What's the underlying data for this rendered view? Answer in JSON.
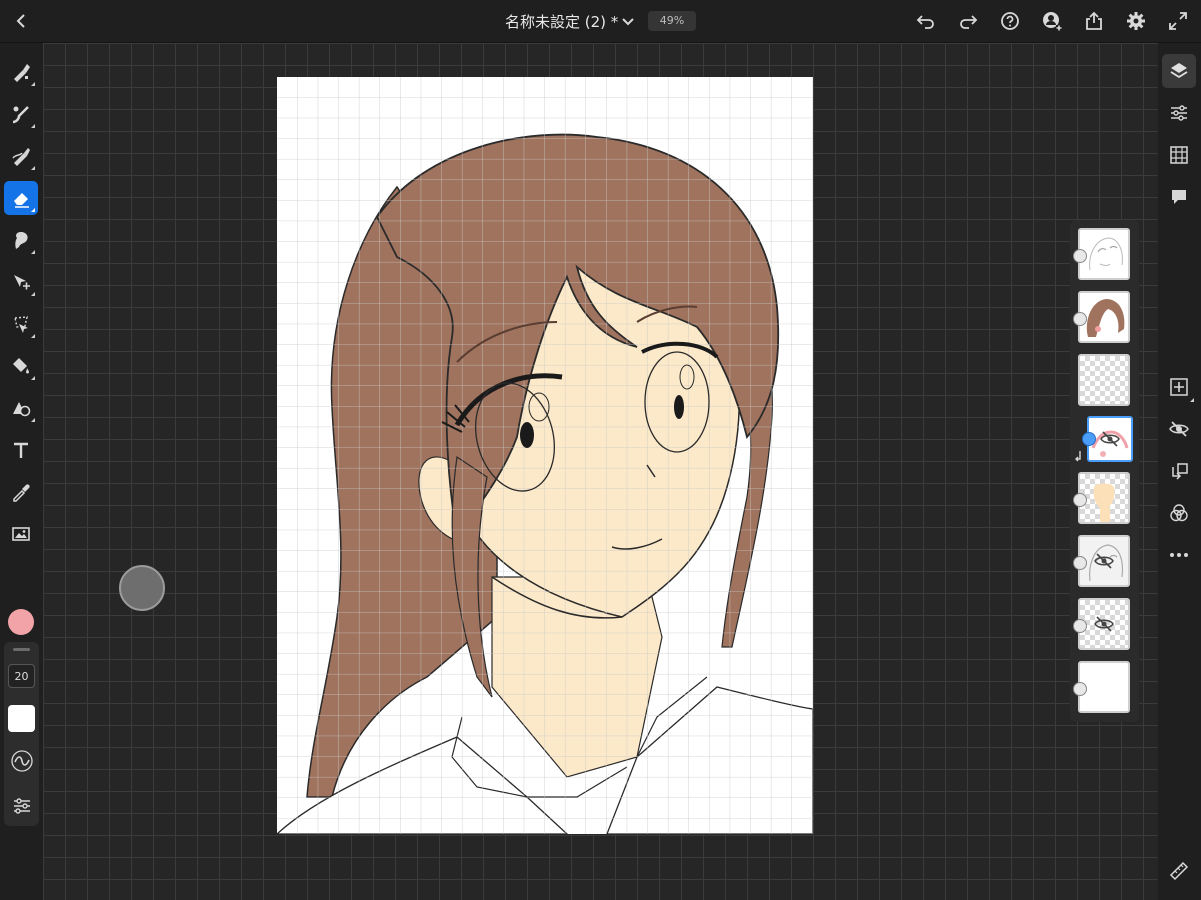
{
  "app": {
    "document_title": "名称未設定 (2) *",
    "zoom": "49%"
  },
  "toolbar_top": {
    "icons": [
      "back-icon",
      "chevron-down-icon",
      "undo-icon",
      "redo-icon",
      "help-icon",
      "share-user-icon",
      "export-icon",
      "gear-icon",
      "fullscreen-icon"
    ]
  },
  "tools": [
    {
      "name": "pixel-brush-tool",
      "active": false
    },
    {
      "name": "live-brush-tool",
      "active": false
    },
    {
      "name": "vector-brush-tool",
      "active": false
    },
    {
      "name": "eraser-tool",
      "active": true
    },
    {
      "name": "smudge-tool",
      "active": false
    },
    {
      "name": "transform-tool",
      "active": false
    },
    {
      "name": "selection-tool",
      "active": false
    },
    {
      "name": "fill-tool",
      "active": false
    },
    {
      "name": "shape-tool",
      "active": false
    },
    {
      "name": "text-tool",
      "active": false
    },
    {
      "name": "eyedropper-tool",
      "active": false
    },
    {
      "name": "image-tool",
      "active": false
    }
  ],
  "brush": {
    "color": "#f2a3a8",
    "size": "20",
    "opacity_color": "#ffffff"
  },
  "colors": {
    "accent": "#1473e6",
    "hair": "#a0735e",
    "skin": "#fce9c9",
    "outline": "#2a2a2a"
  },
  "layers": [
    {
      "name": "sketch-layer",
      "visible": true
    },
    {
      "name": "hair-layer",
      "visible": true
    },
    {
      "name": "empty-layer",
      "visible": true
    },
    {
      "name": "mask-layer",
      "visible": false,
      "selected": true
    },
    {
      "name": "skin-layer",
      "visible": true
    },
    {
      "name": "image-layer",
      "visible": false
    },
    {
      "name": "grid-layer",
      "visible": false
    },
    {
      "name": "background-layer",
      "visible": true
    }
  ]
}
